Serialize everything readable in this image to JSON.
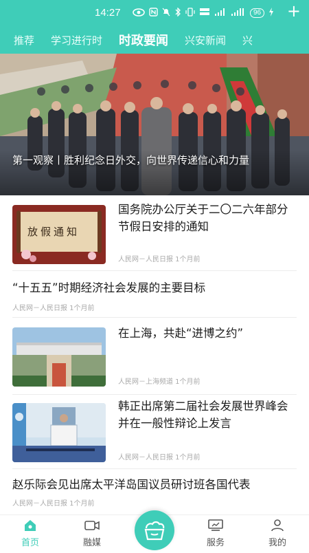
{
  "status_bar": {
    "time": "14:27",
    "battery": "96"
  },
  "tabs": [
    {
      "label": "推荐",
      "active": false
    },
    {
      "label": "学习进行时",
      "active": false
    },
    {
      "label": "时政要闻",
      "active": true
    },
    {
      "label": "兴安新闻",
      "active": false
    },
    {
      "label": "兴",
      "active": false
    }
  ],
  "tab_add_label": "+",
  "hero": {
    "caption": "第一观察丨胜利纪念日外交，向世界传递信心和力量"
  },
  "feed": [
    {
      "title": "国务院办公厅关于二〇二六年部分节假日安排的通知",
      "meta": "人民网－人民日报   1个月前",
      "thumb_text": "放假通知"
    },
    {
      "title": "“十五五”时期经济社会发展的主要目标",
      "meta": "人民网－人民日报   1个月前"
    },
    {
      "title": "在上海，共赴“进博之约”",
      "meta": "人民网－上海频道   1个月前"
    },
    {
      "title": "韩正出席第二届社会发展世界峰会并在一般性辩论上发言",
      "meta": "人民网－人民日报   1个月前"
    },
    {
      "title": "赵乐际会见出席太平洋岛国议员研讨班各国代表",
      "meta": "人民网－人民日报   1个月前"
    }
  ],
  "bottom_nav": [
    {
      "label": "首页",
      "icon": "home-icon",
      "active": true
    },
    {
      "label": "融媒",
      "icon": "video-camera-icon",
      "active": false
    },
    {
      "label": "服务",
      "icon": "monitor-icon",
      "active": false
    },
    {
      "label": "我的",
      "icon": "user-icon",
      "active": false
    }
  ],
  "colors": {
    "accent": "#3fcdb8"
  }
}
